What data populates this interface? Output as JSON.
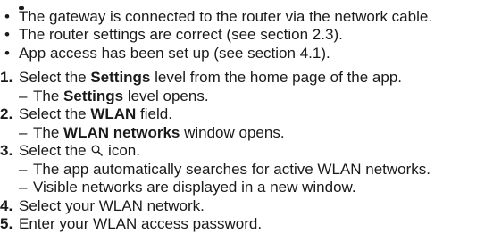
{
  "bullets": [
    "The gateway is connected to the router via the network cable.",
    "The router settings are correct (see section 2.3).",
    "App access has been set up (see section 4.1)."
  ],
  "steps": [
    {
      "number": "1.",
      "pre": "Select the ",
      "bold": "Settings",
      "post": " level from the home page of the app.",
      "results": [
        {
          "pre": "The ",
          "bold": "Settings",
          "post": " level opens."
        }
      ]
    },
    {
      "number": "2.",
      "pre": "Select the ",
      "bold": "WLAN",
      "post": " field.",
      "results": [
        {
          "pre": "The ",
          "bold": "WLAN networks",
          "post": " window opens."
        }
      ]
    },
    {
      "number": "3.",
      "pre": "Select the ",
      "icon": "search-icon",
      "post": " icon.",
      "results": [
        {
          "pre": "The app automatically searches for active WLAN networks.",
          "bold": "",
          "post": ""
        },
        {
          "pre": "Visible networks are displayed in a new window.",
          "bold": "",
          "post": ""
        }
      ]
    },
    {
      "number": "4.",
      "pre": "Select your WLAN network.",
      "bold": "",
      "post": "",
      "results": []
    },
    {
      "number": "5.",
      "pre": "Enter your WLAN access password.",
      "bold": "",
      "post": "",
      "results": []
    }
  ],
  "bullet_glyph": "•",
  "dash_glyph": "–"
}
